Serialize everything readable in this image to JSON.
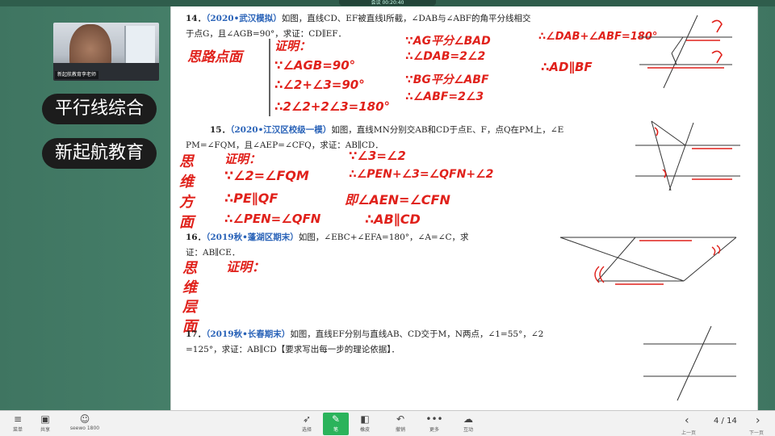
{
  "window": {
    "top_indicator": "会议 00:20:40"
  },
  "camera": {
    "label": "新起航教育李老师"
  },
  "pills": {
    "title": "平行线综合",
    "brand": "新起航教育"
  },
  "problems": {
    "p14": {
      "number": "14．",
      "source": "（2020•武汉模拟）",
      "line1": "如图，直线CD、EF被直线l所截，∠DAB与∠ABF的角平分线相交",
      "line2": "于点G，且∠AGB=90°，求证：CD∥EF．"
    },
    "p15": {
      "number": "15．",
      "source": "（2020•江汉区校级一模）",
      "line1": "如图，直线MN分别交AB和CD于点E、F，点Q在PM上，∠E",
      "line2": "PM=∠FQM，且∠AEP=∠CFQ，求证：AB∥CD．"
    },
    "p16": {
      "number": "16．",
      "source": "（2019秋•蓬湖区期末）",
      "line1": "如图，∠EBC+∠EFA=180°，∠A=∠C，求",
      "line2": "证：AB∥CE．"
    },
    "p17": {
      "number": "17．",
      "source": "（2019秋•长春期末）",
      "line1": "如图，直线EF分别与直线AB、CD交于M，N两点，∠1=55°，∠2",
      "line2": "=125°，求证：AB∥CD【要求写出每一步的理论依据】．"
    }
  },
  "handwriting": {
    "p14_side": "思路点面",
    "p14_col1": [
      "证明：",
      "∵∠AGB=90°",
      "∴∠2+∠3=90°",
      "∴2∠2+2∠3=180°"
    ],
    "p14_col2": [
      "∵AG平分∠BAD",
      "∴∠DAB=2∠2",
      "∵BG平分∠ABF",
      "∴∠ABF=2∠3"
    ],
    "p14_col3": [
      "∴∠DAB+∠ABF=180°",
      "∴AD∥BF"
    ],
    "p15_side": [
      "思",
      "维",
      "方",
      "面"
    ],
    "p15_col1": [
      "证明：",
      "∵∠2=∠FQM",
      "∴PE∥QF",
      "∴∠PEN=∠QFN"
    ],
    "p15_col2": [
      "∵∠3=∠2",
      "∴∠PEN+∠3=∠QFN+∠2",
      "即∠AEN=∠CFN",
      "∴AB∥CD"
    ],
    "p16_side": [
      "思",
      "维",
      "层",
      "面"
    ],
    "p16_text": "证明："
  },
  "toolbar": {
    "items": [
      {
        "label": "菜单",
        "icon": "menu-icon"
      },
      {
        "label": "共享",
        "icon": "share-icon"
      },
      {
        "label": "seewo 1800",
        "icon": "avatar-icon"
      },
      {
        "label": "选择",
        "icon": "cursor-icon"
      },
      {
        "label": "笔",
        "icon": "pen-icon"
      },
      {
        "label": "橡皮",
        "icon": "eraser-icon"
      },
      {
        "label": "撤销",
        "icon": "undo-icon"
      },
      {
        "label": "更多",
        "icon": "more-icon"
      },
      {
        "label": "互动",
        "icon": "interact-icon"
      }
    ],
    "pager": {
      "text": "4 / 14",
      "prev": "‹",
      "next": "›",
      "prev_label": "上一页",
      "next_label": "下一页"
    }
  }
}
